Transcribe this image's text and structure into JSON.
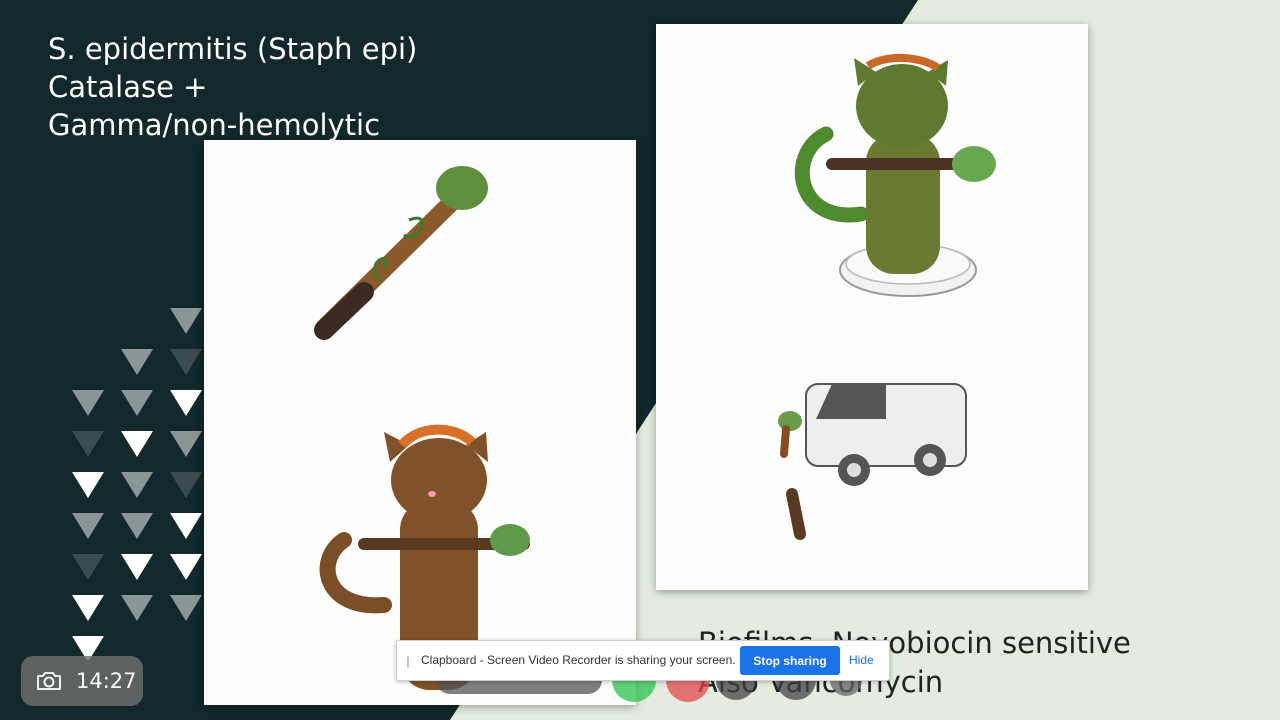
{
  "slide": {
    "title_lines": [
      "S.  epidermitis (Staph epi)",
      "Catalase +",
      "Gamma/non-hemolytic"
    ],
    "caption_lines": [
      "Biofilms, Novobiocin sensitive",
      "Also Vancomycin"
    ],
    "colors": {
      "dark_bg": "#12282b",
      "light_bg": "#e3ecdf",
      "triangle_white": "#ffffff",
      "triangle_gray": "#8a9596",
      "triangle_dark": "#3a4c4e"
    },
    "left_panel": {
      "illustrations": [
        "club-with-vine",
        "cat-holding-club"
      ]
    },
    "right_panel": {
      "illustrations": [
        "cat-standing-in-petri-dish",
        "van-with-broken-club"
      ]
    }
  },
  "share_bar": {
    "message": "Clapboard - Screen Video Recorder is sharing your screen.",
    "stop_label": "Stop sharing",
    "hide_label": "Hide"
  },
  "recorder": {
    "icon": "camera-icon",
    "time": "14:27"
  }
}
